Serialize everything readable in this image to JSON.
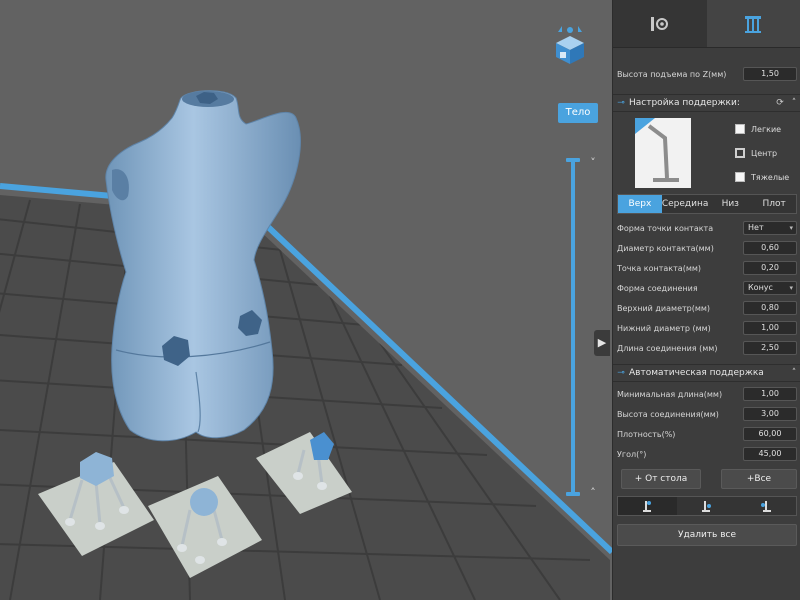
{
  "viewport": {
    "view_mode_label": "Тело",
    "chevron_up": "˄",
    "chevron_down": "˅",
    "collapse_arrow": "▶"
  },
  "panel": {
    "tabs": [
      {
        "name": "print-settings-tab",
        "icon": "settings-icon",
        "active": false
      },
      {
        "name": "supports-tab",
        "icon": "supports-icon",
        "active": true
      }
    ],
    "lift_height": {
      "label": "Высота подъема по Z(мм)",
      "value": "1,50"
    },
    "support_settings": {
      "title": "Настройка поддержки:",
      "options": [
        {
          "label": "Легкие",
          "checked": false
        },
        {
          "label": "Центр",
          "checked": true
        },
        {
          "label": "Тяжелые",
          "checked": false
        }
      ],
      "section_tabs": [
        {
          "label": "Верх",
          "active": true
        },
        {
          "label": "Середина",
          "active": false
        },
        {
          "label": "Низ",
          "active": false
        },
        {
          "label": "Плот",
          "active": false
        }
      ],
      "fields": [
        {
          "label": "Форма точки контакта",
          "value": "Нет",
          "type": "select"
        },
        {
          "label": "Диаметр контакта(мм)",
          "value": "0,60",
          "type": "number"
        },
        {
          "label": "Точка контакта(мм)",
          "value": "0,20",
          "type": "number"
        },
        {
          "label": "Форма соединения",
          "value": "Конус",
          "type": "select"
        },
        {
          "label": "Верхний диаметр(мм)",
          "value": "0,80",
          "type": "number"
        },
        {
          "label": "Нижний диаметр (мм)",
          "value": "1,00",
          "type": "number"
        },
        {
          "label": "Длина соединения (мм)",
          "value": "2,50",
          "type": "number"
        }
      ]
    },
    "auto_support": {
      "title": "Автоматическая поддержка",
      "fields": [
        {
          "label": "Минимальная длина(мм)",
          "value": "1,00"
        },
        {
          "label": "Высота соединения(мм)",
          "value": "3,00"
        },
        {
          "label": "Плотность(%)",
          "value": "60,00"
        },
        {
          "label": "Угол(°)",
          "value": "45,00"
        }
      ]
    },
    "buttons": {
      "from_table": "+ От стола",
      "all": "+Все"
    },
    "delete_all": "Удалить все"
  },
  "colors": {
    "accent": "#4aa3df",
    "model": "#8eb4d6",
    "grid_floor": "#4c4c4c",
    "raft": "#c9cfc9",
    "panel_bg": "#3d3d3d"
  }
}
